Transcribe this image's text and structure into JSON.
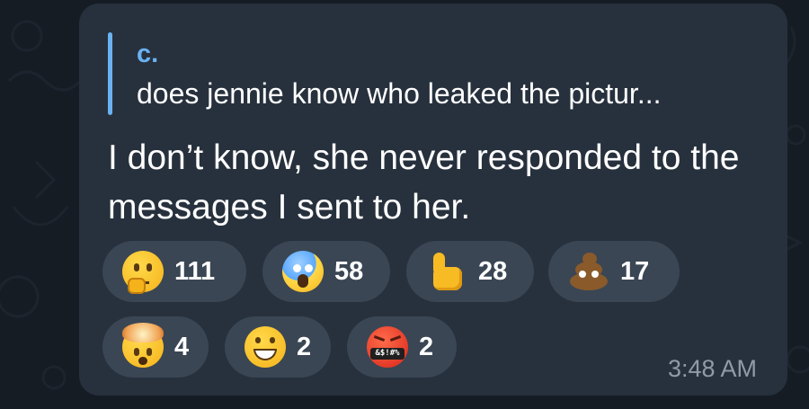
{
  "reply": {
    "author": "c.",
    "text": "does jennie know who leaked the pictur..."
  },
  "message": {
    "text": "I don’t know, she never responded to the messages I sent to her.",
    "time": "3:48 AM"
  },
  "reactions": [
    {
      "emoji": "thinking-face",
      "count": "111"
    },
    {
      "emoji": "face-screaming-in-fear",
      "count": "58"
    },
    {
      "emoji": "thumbs-up",
      "count": "28"
    },
    {
      "emoji": "pile-of-poo",
      "count": "17"
    },
    {
      "emoji": "exploding-head",
      "count": "4"
    },
    {
      "emoji": "grinning-face",
      "count": "2"
    },
    {
      "emoji": "face-with-symbols-on-mouth",
      "count": "2"
    }
  ],
  "emoji_text": {
    "curse_symbols": "&$!#%"
  },
  "colors": {
    "bubble": "#27313d",
    "reaction_pill": "#3a4654",
    "reply_accent": "#6ab2f2",
    "time": "#8f9ba8"
  }
}
